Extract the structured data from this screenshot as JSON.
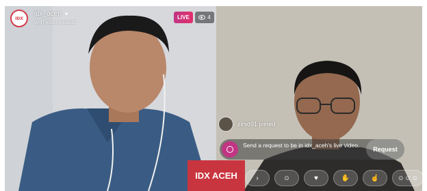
{
  "header": {
    "host_username": "idx_aceh",
    "host_avatar_text": "IDX",
    "with_text": "with indonesiastc",
    "live_label": "LIVE",
    "viewer_count": "4"
  },
  "comments": {
    "joined_text": "zlrsd91 joined"
  },
  "request": {
    "text": "Send a request to be in idx_aceh's live video.",
    "button_label": "Request"
  },
  "reactions": [
    {
      "icon": "chevron-icon",
      "glyph": "›"
    },
    {
      "icon": "grin-emoji-icon",
      "glyph": "☺"
    },
    {
      "icon": "heart-eyes-emoji-icon",
      "glyph": "♥"
    },
    {
      "icon": "wave-hand-icon",
      "glyph": "✋"
    },
    {
      "icon": "point-hand-icon",
      "glyph": "☝"
    },
    {
      "icon": "laugh-emoji-icon",
      "glyph": "☺☺☺"
    }
  ],
  "watermark": {
    "text": "IDX ACEH"
  },
  "colors": {
    "live_accent": "#e1306c",
    "watermark_red": "#c9353f"
  }
}
